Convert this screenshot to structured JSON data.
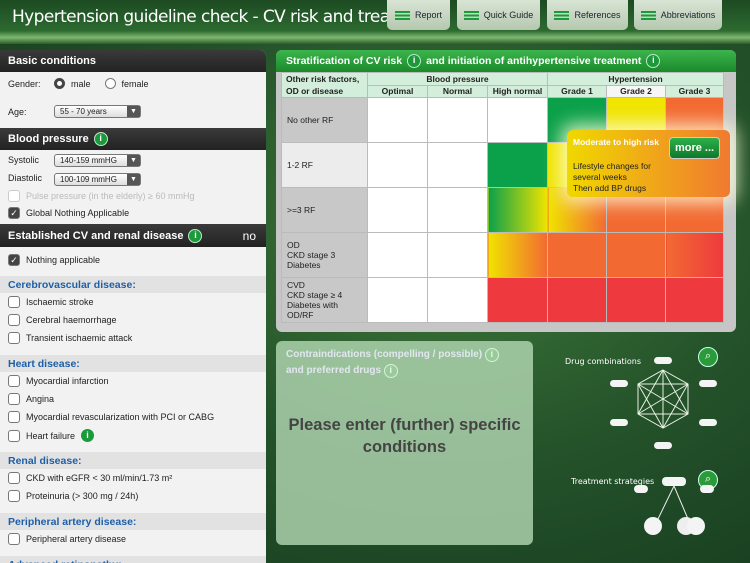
{
  "header": {
    "title": "Hypertension guideline check - CV risk and treatment",
    "buttons": [
      "Report",
      "Quick Guide",
      "References",
      "Abbreviations"
    ]
  },
  "left": {
    "basic": {
      "title": "Basic conditions",
      "gender_label": "Gender:",
      "male": "male",
      "female": "female",
      "age_label": "Age:",
      "age_value": "55 - 70 years"
    },
    "bp": {
      "title": "Blood pressure",
      "info": "i",
      "systolic_label": "Systolic",
      "systolic_value": "140-159 mmHG",
      "diastolic_label": "Diastolic",
      "diastolic_value": "100-109 mmHG",
      "pulse": "Pulse pressure (in the elderly) ≥ 60 mmHg",
      "global": "Global Nothing Applicable"
    },
    "established": {
      "title": "Established CV and renal disease",
      "info": "i",
      "status": "no",
      "nothing": "Nothing applicable"
    },
    "categories": [
      {
        "title": "Cerebrovascular disease:",
        "items": [
          "Ischaemic stroke",
          "Cerebral haemorrhage",
          "Transient ischaemic attack"
        ]
      },
      {
        "title": "Heart disease:",
        "items": [
          "Myocardial infarction",
          "Angina",
          "Myocardial revascularization with PCI or CABG",
          "Heart failure"
        ]
      },
      {
        "title": "Renal disease:",
        "items": [
          "CKD with eGFR < 30 ml/min/1.73 m²",
          "Proteinuria (> 300 mg / 24h)"
        ]
      },
      {
        "title": "Peripheral artery disease:",
        "items": [
          "Peripheral artery disease"
        ]
      },
      {
        "title": "Advanced retinopathy:",
        "items": []
      }
    ]
  },
  "strat": {
    "title_a": "Stratification of CV risk",
    "title_b": "and initiation of antihypertensive treatment",
    "info": "i",
    "col0": "Other risk factors, OD or disease",
    "group_bp": "Blood pressure",
    "group_ht": "Hypertension",
    "cols": [
      "Optimal",
      "Normal",
      "High normal",
      "Grade 1",
      "Grade 2",
      "Grade 3"
    ],
    "rows": [
      "No other RF",
      "1-2 RF",
      ">=3 RF",
      "OD\nCKD stage 3\nDiabetes",
      "CVD\nCKD stage ≥ 4\nDiabetes with\nOD/RF"
    ],
    "colors": {
      "green": "#0ba04a",
      "yellow": "#f0e400",
      "orange": "#f26a32",
      "red": "#ee3a3e"
    }
  },
  "popup": {
    "title": "Moderate to high risk",
    "more": "more ...",
    "text1": "Lifestyle changes for",
    "text2": "several weeks",
    "text3": "Then add BP drugs"
  },
  "contra": {
    "title1": "Contraindications (compelling / possible)",
    "title2": "and preferred drugs",
    "info": "i",
    "message": "Please enter (further) specific conditions"
  },
  "diagrams": {
    "drug": "Drug combinations",
    "strategies": "Treatment strategies"
  }
}
